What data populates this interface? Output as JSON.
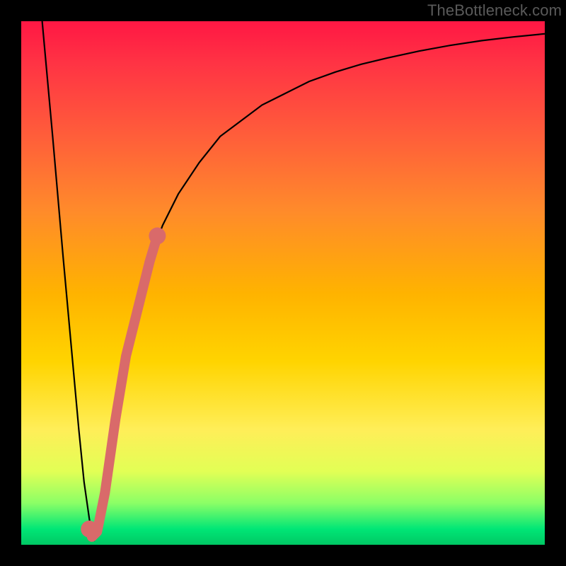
{
  "watermark": "TheBottleneck.com",
  "chart_data": {
    "type": "line",
    "title": "",
    "xlabel": "",
    "ylabel": "",
    "xlim": [
      0,
      100
    ],
    "ylim": [
      0,
      100
    ],
    "series": [
      {
        "name": "bottleneck-curve",
        "x": [
          4,
          6,
          8,
          10,
          11,
          12,
          13,
          13.5,
          14,
          15,
          16,
          18,
          20,
          22,
          24,
          27,
          30,
          34,
          38,
          42,
          46,
          50,
          55,
          60,
          65,
          70,
          76,
          82,
          88,
          94,
          100
        ],
        "y": [
          100,
          78,
          55,
          33,
          22,
          12,
          5,
          2,
          1,
          4,
          10,
          24,
          36,
          46,
          53,
          61,
          67,
          73,
          78,
          81,
          84,
          86,
          88.5,
          90.3,
          91.8,
          93,
          94.3,
          95.4,
          96.3,
          97,
          97.6
        ]
      },
      {
        "name": "highlight-segment",
        "x": [
          13.0,
          13.5,
          14.5,
          16.0,
          18.0,
          20.0,
          21.5,
          23.0,
          24.5,
          26.0
        ],
        "y": [
          3.0,
          1.5,
          2.5,
          10.0,
          24.0,
          36.0,
          42.0,
          48.0,
          54.0,
          59.0
        ]
      }
    ],
    "highlight_style": {
      "color": "#d96a6a",
      "cap_radius": 12,
      "stroke_width": 14
    },
    "gradient_stops": [
      {
        "pos": 0.0,
        "color": "#ff1744"
      },
      {
        "pos": 0.22,
        "color": "#ff5e3a"
      },
      {
        "pos": 0.52,
        "color": "#ffb300"
      },
      {
        "pos": 0.78,
        "color": "#ffee58"
      },
      {
        "pos": 0.92,
        "color": "#8cff66"
      },
      {
        "pos": 1.0,
        "color": "#00c864"
      }
    ]
  }
}
